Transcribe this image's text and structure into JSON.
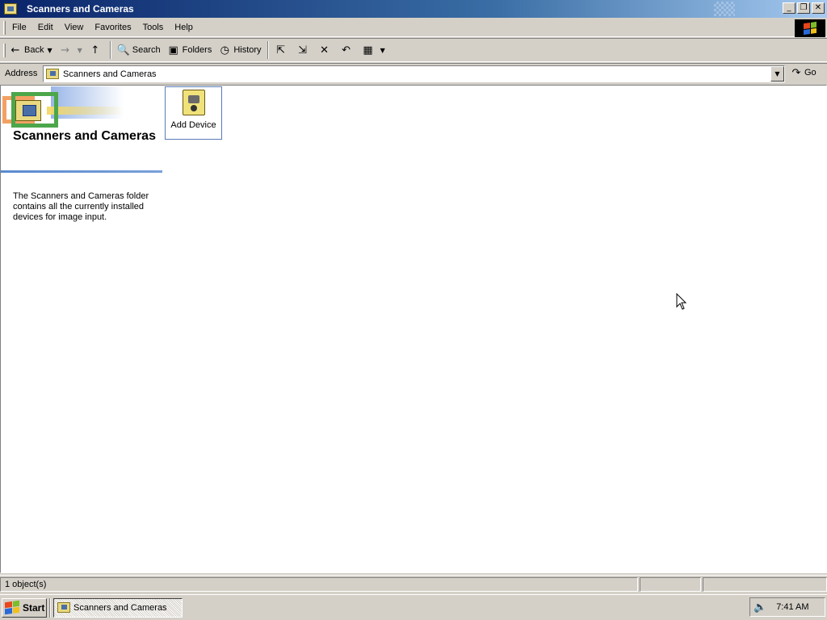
{
  "window": {
    "title": "Scanners and Cameras",
    "controls": {
      "minimize": "_",
      "restore": "❐",
      "close": "✕"
    }
  },
  "menu": {
    "items": [
      {
        "label": "File"
      },
      {
        "label": "Edit"
      },
      {
        "label": "View"
      },
      {
        "label": "Favorites"
      },
      {
        "label": "Tools"
      },
      {
        "label": "Help"
      }
    ]
  },
  "toolbar": {
    "back_label": "Back",
    "search_label": "Search",
    "folders_label": "Folders",
    "history_label": "History",
    "icons": {
      "back": "←",
      "forward": "→",
      "dropdown": "▼",
      "up": "↑",
      "search": "🔍",
      "folders": "▣",
      "history": "◷",
      "move_to": "⇱",
      "copy_to": "⇲",
      "delete": "✕",
      "undo": "↶",
      "views": "▦"
    }
  },
  "address": {
    "label": "Address",
    "value": "Scanners and Cameras",
    "go_label": "Go",
    "go_icon": "↷"
  },
  "panel": {
    "title": "Scanners and Cameras",
    "description": "The Scanners and Cameras folder contains all the currently installed devices for image input."
  },
  "items": [
    {
      "label": "Add Device"
    }
  ],
  "status": {
    "text": "1 object(s)"
  },
  "taskbar": {
    "start_label": "Start",
    "task_label": "Scanners and Cameras",
    "volume_icon": "🔈",
    "clock": "7:41 AM"
  }
}
